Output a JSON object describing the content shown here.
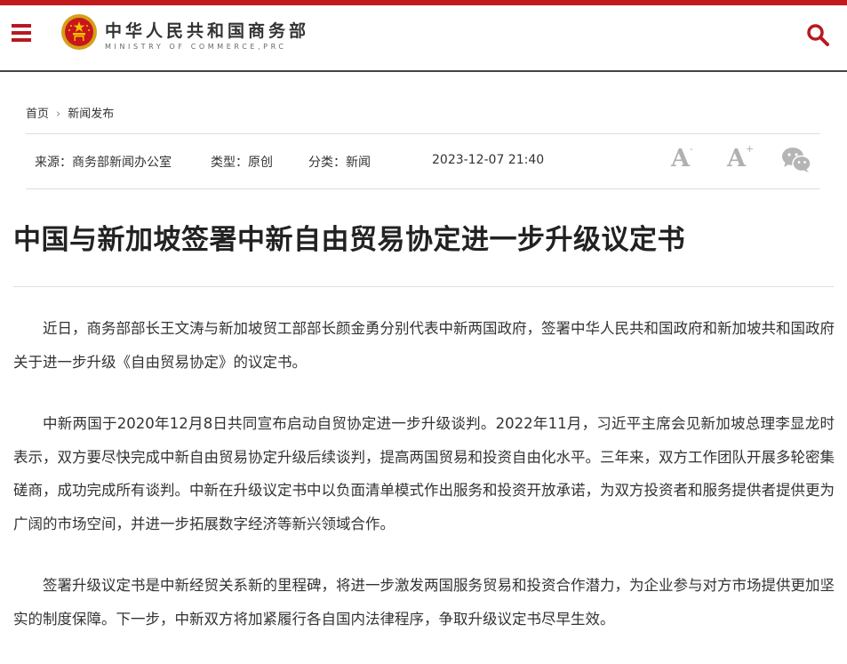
{
  "header": {
    "site_name": "中华人民共和国商务部",
    "site_name_en": "MINISTRY OF COMMERCE,PRC",
    "menu_icon": "hamburger-menu-icon",
    "search_icon": "search-icon",
    "brand_color": "#c2191f"
  },
  "breadcrumb": {
    "home": "首页",
    "separator": "›",
    "current": "新闻发布"
  },
  "meta": {
    "source": "来源：商务部新闻办公室",
    "type": "类型：原创",
    "category": "分类：新闻",
    "datetime": "2023-12-07 21:40",
    "font_smaller": "A",
    "font_smaller_mark": "-",
    "font_larger": "A",
    "font_larger_mark": "+",
    "share_icon": "wechat-icon"
  },
  "article": {
    "title": "中国与新加坡签署中新自由贸易协定进一步升级议定书",
    "paragraphs": [
      "近日，商务部部长王文涛与新加坡贸工部部长颜金勇分别代表中新两国政府，签署中华人民共和国政府和新加坡共和国政府关于进一步升级《自由贸易协定》的议定书。",
      "中新两国于2020年12月8日共同宣布启动自贸协定进一步升级谈判。2022年11月，习近平主席会见新加坡总理李显龙时表示，双方要尽快完成中新自由贸易协定升级后续谈判，提高两国贸易和投资自由化水平。三年来，双方工作团队开展多轮密集磋商，成功完成所有谈判。中新在升级议定书中以负面清单模式作出服务和投资开放承诺，为双方投资者和服务提供者提供更为广阔的市场空间，并进一步拓展数字经济等新兴领域合作。",
      "签署升级议定书是中新经贸关系新的里程碑，将进一步激发两国服务贸易和投资合作潜力，为企业参与对方市场提供更加坚实的制度保障。下一步，中新双方将加紧履行各自国内法律程序，争取升级议定书尽早生效。"
    ]
  }
}
